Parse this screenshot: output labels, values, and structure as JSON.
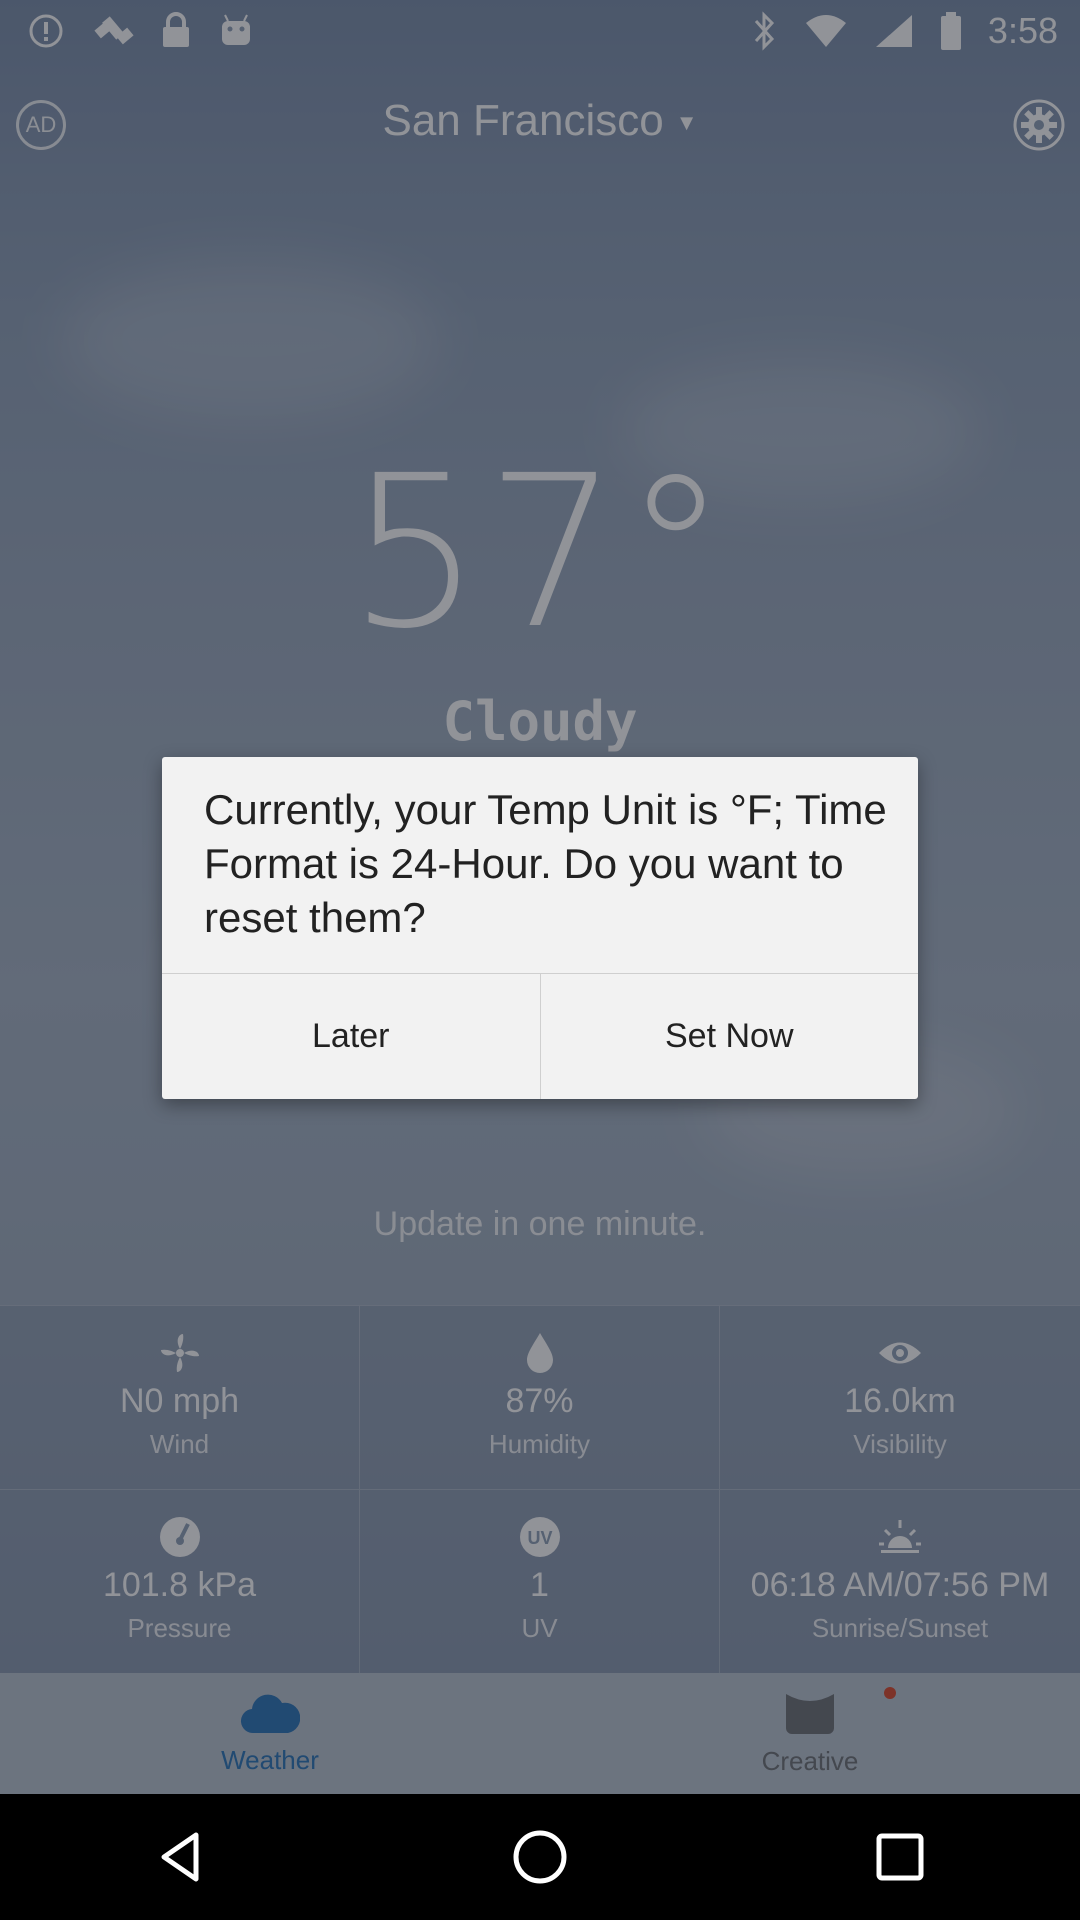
{
  "status_bar": {
    "time": "3:58",
    "icons": [
      "alert-icon",
      "satellite-icon",
      "lock-icon",
      "android-icon",
      "bluetooth-icon",
      "wifi-icon",
      "signal-icon",
      "battery-icon"
    ]
  },
  "header": {
    "ad_label": "AD",
    "city": "San Francisco",
    "caret": "▼"
  },
  "weather": {
    "temperature": "57°",
    "condition": "Cloudy",
    "update_text": "Update in one minute."
  },
  "stats": [
    {
      "icon": "wind-fan-icon",
      "value": "N0 mph",
      "label": "Wind"
    },
    {
      "icon": "droplet-icon",
      "value": "87%",
      "label": "Humidity"
    },
    {
      "icon": "eye-icon",
      "value": "16.0km",
      "label": "Visibility"
    },
    {
      "icon": "gauge-icon",
      "value": "101.8 kPa",
      "label": "Pressure"
    },
    {
      "icon": "uv-icon",
      "value": "1",
      "label": "UV"
    },
    {
      "icon": "sunrise-icon",
      "value": "06:18 AM/07:56 PM",
      "label": "Sunrise/Sunset"
    }
  ],
  "tabs": [
    {
      "label": "Weather",
      "icon": "cloud-icon",
      "active": true
    },
    {
      "label": "Creative",
      "icon": "bag-icon",
      "active": false
    }
  ],
  "dialog": {
    "message": "Currently, your Temp Unit is °F; Time Format is 24-Hour. Do you want to reset them?",
    "later_label": "Later",
    "set_now_label": "Set Now"
  },
  "colors": {
    "accent": "#2a73b6",
    "dialog_bg": "#f2f2f2",
    "badge_dot": "#d9472b"
  }
}
